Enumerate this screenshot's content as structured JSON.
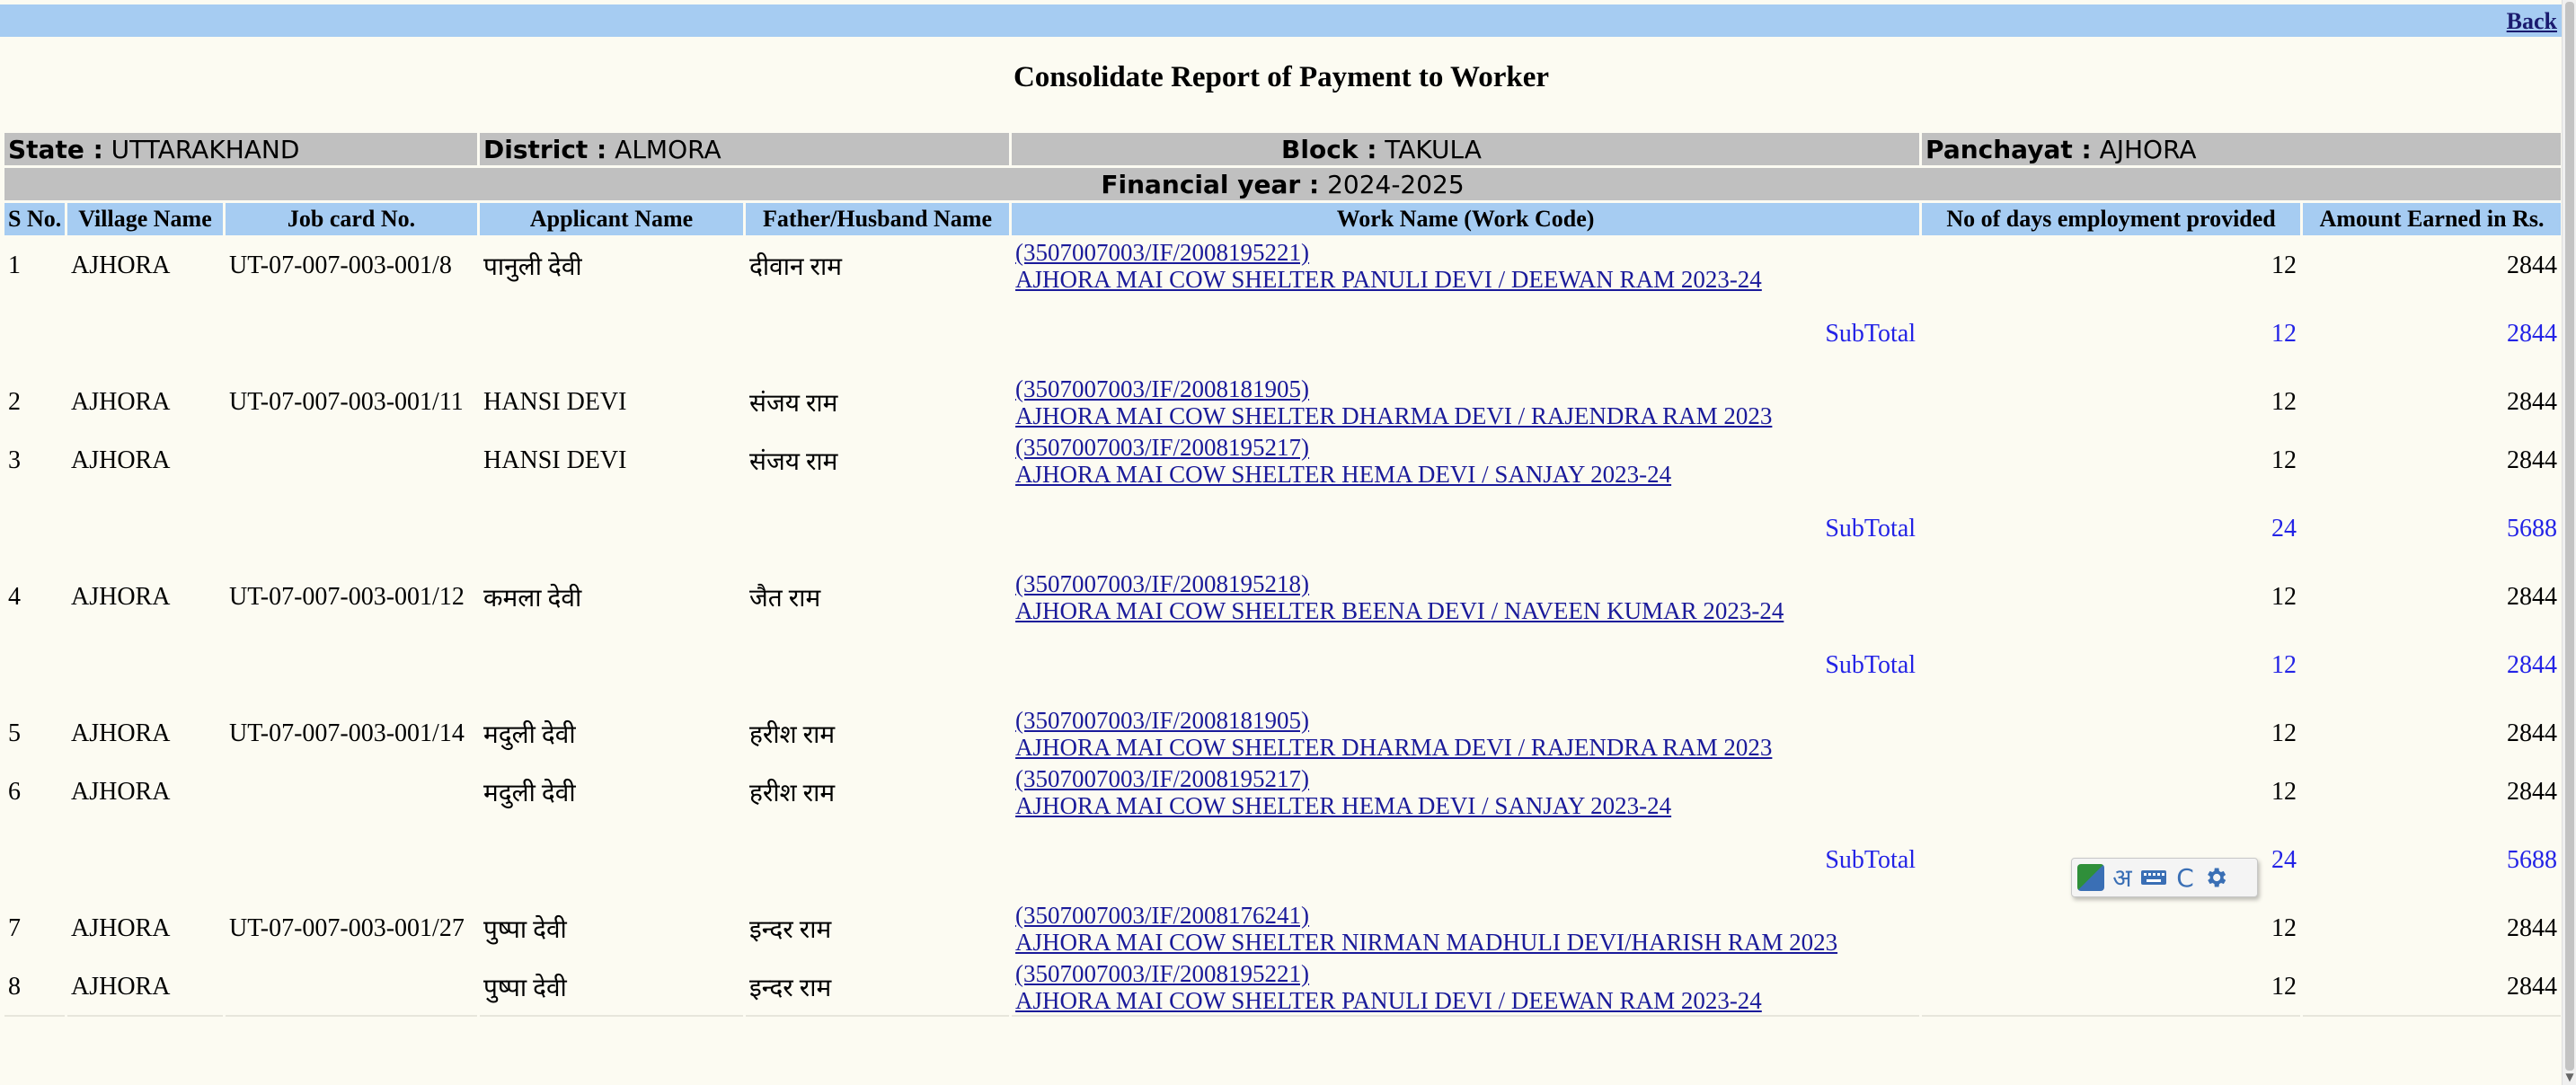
{
  "header": {
    "back_label": "Back",
    "title": "Consolidate Report of Payment to Worker"
  },
  "info": {
    "state_label": "State :",
    "state_value": "UTTARAKHAND",
    "district_label": "District :",
    "district_value": "ALMORA",
    "block_label": "Block :",
    "block_value": "TAKULA",
    "panchayat_label": "Panchayat :",
    "panchayat_value": "AJHORA",
    "fy_label": "Financial year :",
    "fy_value": "2024-2025"
  },
  "columns": [
    "S No.",
    "Village Name",
    "Job card No.",
    "Applicant Name",
    "Father/Husband Name",
    "Work Name (Work Code)",
    "No of days employment provided",
    "Amount Earned in Rs."
  ],
  "subtotal_label": "SubTotal",
  "rows": [
    {
      "type": "row",
      "sno": "1",
      "village": "AJHORA",
      "jobcard": "UT-07-007-003-001/8",
      "applicant": "पानुली देवी",
      "father": "दीवान राम",
      "work_code": "(3507007003/IF/2008195221)",
      "work_name": "AJHORA MAI COW SHELTER PANULI DEVI / DEEWAN RAM 2023-24",
      "days": "12",
      "amount": "2844"
    },
    {
      "type": "subtotal",
      "days": "12",
      "amount": "2844"
    },
    {
      "type": "row",
      "sno": "2",
      "village": "AJHORA",
      "jobcard": "UT-07-007-003-001/11",
      "applicant": "HANSI DEVI",
      "father": "संजय राम",
      "work_code": "(3507007003/IF/2008181905)",
      "work_name": "AJHORA MAI COW SHELTER DHARMA DEVI / RAJENDRA RAM 2023",
      "days": "12",
      "amount": "2844"
    },
    {
      "type": "row",
      "sno": "3",
      "village": "AJHORA",
      "jobcard": "",
      "applicant": "HANSI DEVI",
      "father": "संजय राम",
      "work_code": "(3507007003/IF/2008195217)",
      "work_name": "AJHORA MAI COW SHELTER HEMA DEVI / SANJAY 2023-24",
      "days": "12",
      "amount": "2844"
    },
    {
      "type": "subtotal",
      "days": "24",
      "amount": "5688"
    },
    {
      "type": "row",
      "sno": "4",
      "village": "AJHORA",
      "jobcard": "UT-07-007-003-001/12",
      "applicant": "कमला देवी",
      "father": "जैत राम",
      "work_code": "(3507007003/IF/2008195218)",
      "work_name": "AJHORA MAI COW SHELTER BEENA DEVI / NAVEEN KUMAR 2023-24",
      "days": "12",
      "amount": "2844"
    },
    {
      "type": "subtotal",
      "days": "12",
      "amount": "2844"
    },
    {
      "type": "row",
      "sno": "5",
      "village": "AJHORA",
      "jobcard": "UT-07-007-003-001/14",
      "applicant": "मदुली देवी",
      "father": "हरीश राम",
      "work_code": "(3507007003/IF/2008181905)",
      "work_name": "AJHORA MAI COW SHELTER DHARMA DEVI / RAJENDRA RAM 2023",
      "days": "12",
      "amount": "2844"
    },
    {
      "type": "row",
      "sno": "6",
      "village": "AJHORA",
      "jobcard": "",
      "applicant": "मदुली देवी",
      "father": "हरीश राम",
      "work_code": "(3507007003/IF/2008195217)",
      "work_name": "AJHORA MAI COW SHELTER HEMA DEVI / SANJAY 2023-24",
      "days": "12",
      "amount": "2844"
    },
    {
      "type": "subtotal",
      "days": "24",
      "amount": "5688"
    },
    {
      "type": "row",
      "sno": "7",
      "village": "AJHORA",
      "jobcard": "UT-07-007-003-001/27",
      "applicant": "पुष्पा देवी",
      "father": "इन्दर राम",
      "work_code": "(3507007003/IF/2008176241)",
      "work_name": "AJHORA MAI COW SHELTER NIRMAN MADHULI DEVI/HARISH RAM 2023",
      "days": "12",
      "amount": "2844"
    },
    {
      "type": "row",
      "sno": "8",
      "village": "AJHORA",
      "jobcard": "",
      "applicant": "पुष्पा देवी",
      "father": "इन्दर राम",
      "work_code": "(3507007003/IF/2008195221)",
      "work_name": "AJHORA MAI COW SHELTER PANULI DEVI / DEEWAN RAM 2023-24",
      "days": "12",
      "amount": "2844"
    }
  ],
  "ime_toolbar": {
    "hindi_glyph": "अ",
    "c_label": "C",
    "icons": [
      "ime-logo-icon",
      "keyboard-icon",
      "gear-icon"
    ]
  }
}
